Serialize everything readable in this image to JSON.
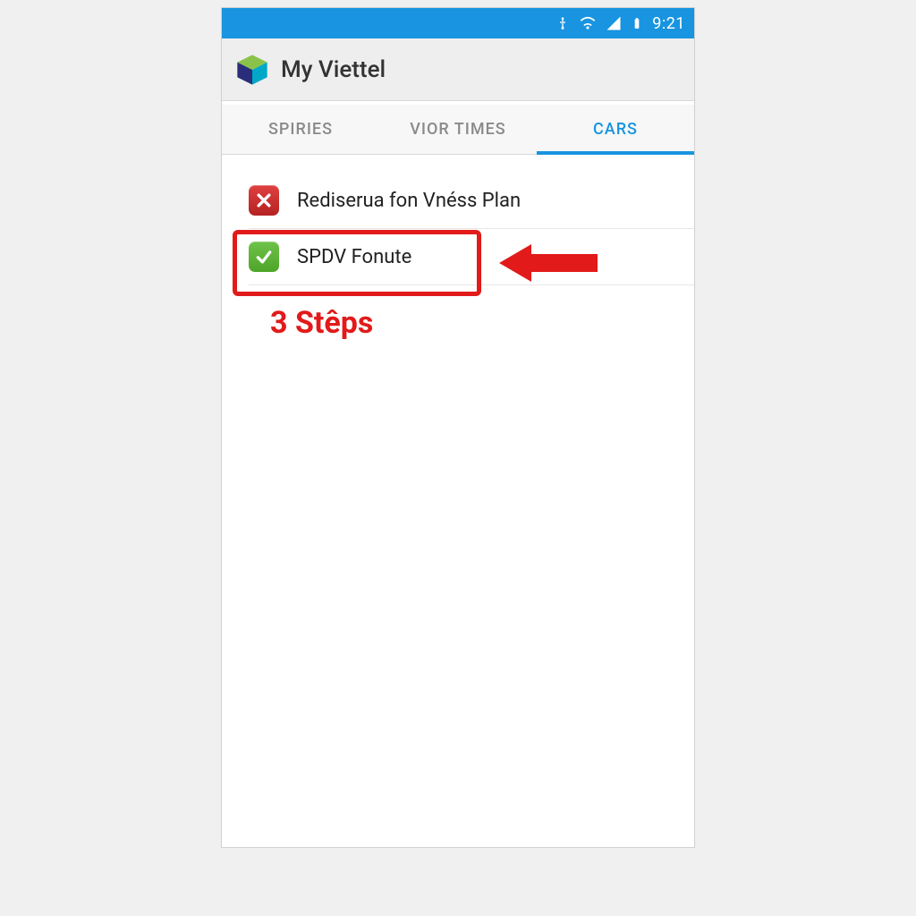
{
  "status_bar": {
    "time": "9:21"
  },
  "app": {
    "title": "My Viettel"
  },
  "tabs": [
    {
      "label": "SPIRIES",
      "active": false
    },
    {
      "label": "VIOR TIMES",
      "active": false
    },
    {
      "label": "CARS",
      "active": true
    }
  ],
  "items": [
    {
      "label": "Rediserua fon Vnéss Plan",
      "status": "off"
    },
    {
      "label": "SPDV Fonute",
      "status": "on"
    }
  ],
  "annotation": {
    "step_label": "3 Stêps"
  },
  "colors": {
    "accent": "#1894e0",
    "annotation": "#e21a1a",
    "status_on": "#5eb336",
    "status_off": "#c8342c"
  }
}
